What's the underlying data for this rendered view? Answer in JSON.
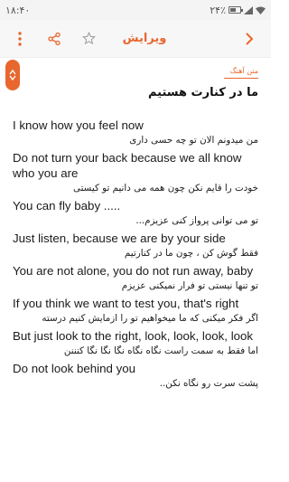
{
  "status_bar": {
    "time": "۱۸:۴۰",
    "battery": "۲۴٪"
  },
  "toolbar": {
    "title": "ویرایش",
    "icons": [
      "more-vertical-icon",
      "share-icon",
      "star-icon",
      "chevron-right-icon"
    ]
  },
  "scroll_handle": {
    "arrows": [
      "chevron-up-icon",
      "chevron-down-icon"
    ]
  },
  "colors": {
    "accent": "#e8672f",
    "text": "#1a1a1a"
  },
  "category_label": "متن آهنگ",
  "song_title": "ما در کنارت هستیم",
  "lyrics": [
    {
      "en": "I know how you feel now",
      "fa": "من میدونم الان تو چه حسی داری"
    },
    {
      "en": "Do not turn your back because we all know who you are",
      "fa": "خودت را قایم نکن چون همه می دانیم تو کیستی"
    },
    {
      "en": "You can fly baby .....",
      "fa": "تو می توانی پرواز کنی عزیزم..."
    },
    {
      "en": "Just listen, because we are by your side",
      "fa": "فقط گوش کن ، چون ما در کنارتیم"
    },
    {
      "en": "You are not alone, you do not run away, baby",
      "fa": "تو تنها نیستی تو فرار نمیکنی عزیزم"
    },
    {
      "en": "If you think we want to test you, that's right",
      "fa": "اگر فکر میکنی که ما میخواهیم تو را ازمایش کنیم درسته"
    },
    {
      "en": "But just look to the right, look, look, look, look",
      "fa": "اما  فقط به سمت راست نگاه نگاه نگا نگا نگا کنننن"
    },
    {
      "en": "Do not look behind you",
      "fa": "پشت سرت رو نگاه نکن.."
    }
  ]
}
